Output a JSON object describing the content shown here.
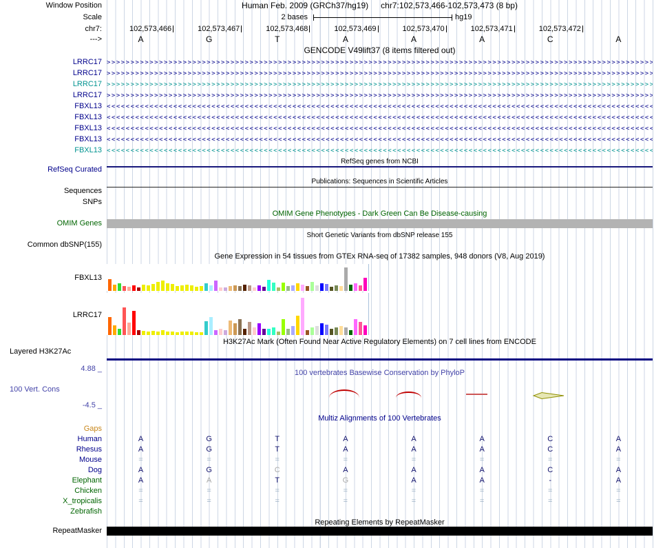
{
  "colors": {
    "navy": "#00008b",
    "teal": "#009390",
    "green": "#006400",
    "conservation_blue": "#4343a8",
    "gaps_orange": "#c8861a",
    "guideline": "#ccd6e4",
    "alignment_letter": "#14146e",
    "alignment_muted": "#a9a9a9",
    "alignment_eq": "#9bb0c4",
    "phylop_red": "#c00000",
    "phylop_olive": "#8f8f00",
    "omim_bar": "#b3b3b3",
    "repeat_bar": "#000000",
    "h3k27ac_line": "#000080"
  },
  "header": {
    "window_position_label": "Window Position",
    "assembly_title": "Human Feb. 2009 (GRCh37/hg19)",
    "position_title": "chr7:102,573,466-102,573,473 (8 bp)",
    "scale_label": "Scale",
    "scale_value": "2 bases",
    "assembly": "hg19",
    "chrom_label": "chr7:",
    "strand_label": "--->",
    "positions": [
      "102,573,466",
      "102,573,467",
      "102,573,468",
      "102,573,469",
      "102,573,470",
      "102,573,471",
      "102,573,472"
    ],
    "bases": [
      "A",
      "G",
      "T",
      "A",
      "A",
      "A",
      "C",
      "A"
    ]
  },
  "gencode": {
    "title": "GENCODE V49lift37 (8 items filtered out)",
    "genes": [
      {
        "label": "LRRC17",
        "direction": "right",
        "color": "#00008b"
      },
      {
        "label": "LRRC17",
        "direction": "right",
        "color": "#00008b"
      },
      {
        "label": "LRRC17",
        "direction": "right",
        "color": "#009390"
      },
      {
        "label": "LRRC17",
        "direction": "right",
        "color": "#00008b"
      },
      {
        "label": "FBXL13",
        "direction": "left",
        "color": "#00008b"
      },
      {
        "label": "FBXL13",
        "direction": "left",
        "color": "#00008b"
      },
      {
        "label": "FBXL13",
        "direction": "left",
        "color": "#00008b"
      },
      {
        "label": "FBXL13",
        "direction": "left",
        "color": "#00008b"
      },
      {
        "label": "FBXL13",
        "direction": "left",
        "color": "#009390"
      }
    ]
  },
  "refseq": {
    "title": "RefSeq genes from NCBI",
    "label": "RefSeq Curated"
  },
  "publications": {
    "title": "Publications: Sequences in Scientific Articles",
    "label": "Sequences"
  },
  "snps": {
    "label": "SNPs"
  },
  "omim": {
    "title": "OMIM Gene Phenotypes - Dark Green Can Be Disease-causing",
    "label": "OMIM Genes"
  },
  "dbsnp": {
    "title": "Short Genetic Variants from dbSNP release 155",
    "label": "Common dbSNP(155)"
  },
  "gtex": {
    "title": "Gene Expression in 54 tissues from GTEx RNA-seq of 17382 samples, 948 donors (V8, Aug 2019)",
    "palette": [
      "#ff6600",
      "#ffaa00",
      "#33dd33",
      "#ff5555",
      "#ffaa99",
      "#ff0000",
      "#aa0000",
      "#eeee00",
      "#eeee00",
      "#eeee00",
      "#eeee00",
      "#eeee00",
      "#eeee00",
      "#eeee00",
      "#eeee00",
      "#eeee00",
      "#eeee00",
      "#eeee00",
      "#eeee00",
      "#eeee00",
      "#33cccc",
      "#aaeeff",
      "#cc66ff",
      "#ffcccc",
      "#ccaadd",
      "#eebb77",
      "#cc9955",
      "#8b7355",
      "#552200",
      "#bb9988",
      "#ffcccc",
      "#9900ff",
      "#660099",
      "#22ffdd",
      "#33ffc2",
      "#aabb66",
      "#99ff00",
      "#99bb88",
      "#aaaaff",
      "#ffd700",
      "#ffaaff",
      "#995522",
      "#aaff99",
      "#dddddd",
      "#0000ff",
      "#7777ff",
      "#555522",
      "#778855",
      "#ffdd99",
      "#aaaaaa",
      "#006600",
      "#ff66ff",
      "#ff5599",
      "#ff00bb"
    ],
    "charts": [
      {
        "label": "FBXL13",
        "heights": [
          17,
          9,
          11,
          7,
          6,
          8,
          5,
          9,
          8,
          10,
          13,
          15,
          11,
          10,
          7,
          8,
          9,
          8,
          6,
          7,
          11,
          8,
          15,
          5,
          5,
          7,
          8,
          7,
          9,
          8,
          5,
          8,
          6,
          16,
          12,
          5,
          12,
          7,
          8,
          11,
          9,
          7,
          13,
          8,
          11,
          10,
          6,
          8,
          7,
          34,
          9,
          11,
          8,
          19
        ]
      },
      {
        "label": "LRRC17",
        "heights": [
          26,
          14,
          9,
          40,
          18,
          35,
          7,
          6,
          5,
          6,
          5,
          7,
          5,
          5,
          4,
          5,
          5,
          5,
          4,
          4,
          20,
          26,
          7,
          9,
          7,
          21,
          17,
          23,
          9,
          19,
          11,
          17,
          9,
          9,
          11,
          5,
          23,
          9,
          13,
          28,
          54,
          7,
          11,
          13,
          17,
          15,
          9,
          11,
          13,
          11,
          7,
          23,
          19,
          14
        ]
      }
    ]
  },
  "h3k27ac": {
    "title": "H3K27Ac Mark (Often Found Near Active Regulatory Elements) on 7 cell lines from ENCODE",
    "label": "Layered H3K27Ac"
  },
  "conservation": {
    "title": "100 vertebrates Basewise Conservation by PhyloP",
    "label": "100 Vert. Cons",
    "max_label": "4.88 _",
    "min_label": "-4.5 _"
  },
  "multiz": {
    "title": "Multiz Alignments of 100 Vertebrates",
    "rows": [
      {
        "label": "Gaps",
        "label_color": "#c8861a",
        "cells": [
          "",
          "",
          "",
          "",
          "",
          "",
          "",
          ""
        ]
      },
      {
        "label": "Human",
        "label_color": "#00008b",
        "cells": [
          "A",
          "G",
          "T",
          "A",
          "A",
          "A",
          "C",
          "A"
        ]
      },
      {
        "label": "Rhesus",
        "label_color": "#00008b",
        "cells": [
          "A",
          "G",
          "T",
          "A",
          "A",
          "A",
          "C",
          "A"
        ]
      },
      {
        "label": "Mouse",
        "label_color": "#00008b",
        "cells": [
          "=",
          "=",
          "=",
          "=",
          "=",
          "=",
          "=",
          "="
        ]
      },
      {
        "label": "Dog",
        "label_color": "#00008b",
        "cells": [
          "A",
          "G",
          "C*",
          "A",
          "A",
          "A",
          "C",
          "A"
        ]
      },
      {
        "label": "Elephant",
        "label_color": "#006400",
        "cells": [
          "A",
          "A*",
          "T",
          "G*",
          "A",
          "A",
          "-",
          "A"
        ]
      },
      {
        "label": "Chicken",
        "label_color": "#006400",
        "cells": [
          "=",
          "=",
          "=",
          "=",
          "=",
          "=",
          "=",
          "="
        ]
      },
      {
        "label": "X_tropicalis",
        "label_color": "#006400",
        "cells": [
          "=",
          "=",
          "=",
          "=",
          "=",
          "=",
          "=",
          "="
        ]
      },
      {
        "label": "Zebrafish",
        "label_color": "#006400",
        "cells": [
          "",
          "",
          "",
          "",
          "",
          "",
          "",
          ""
        ]
      }
    ]
  },
  "repeatmasker": {
    "title": "Repeating Elements by RepeatMasker",
    "label": "RepeatMasker"
  }
}
